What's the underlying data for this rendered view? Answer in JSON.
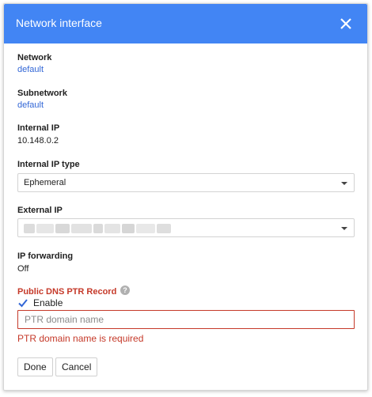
{
  "dialog": {
    "title": "Network interface",
    "close_icon": "close-icon"
  },
  "network": {
    "label": "Network",
    "value": "default"
  },
  "subnetwork": {
    "label": "Subnetwork",
    "value": "default"
  },
  "internal_ip": {
    "label": "Internal IP",
    "value": "10.148.0.2"
  },
  "internal_ip_type": {
    "label": "Internal IP type",
    "selected": "Ephemeral"
  },
  "external_ip": {
    "label": "External IP",
    "selected_redacted": true
  },
  "ip_forwarding": {
    "label": "IP forwarding",
    "value": "Off"
  },
  "dns_ptr": {
    "label": "Public DNS PTR Record",
    "help_icon": "help-icon",
    "enable_label": "Enable",
    "enabled": true,
    "placeholder": "PTR domain name",
    "error": "PTR domain name is required"
  },
  "actions": {
    "done": "Done",
    "cancel": "Cancel"
  },
  "colors": {
    "header": "#4285f4",
    "link": "#3367d6",
    "error": "#c53929"
  }
}
